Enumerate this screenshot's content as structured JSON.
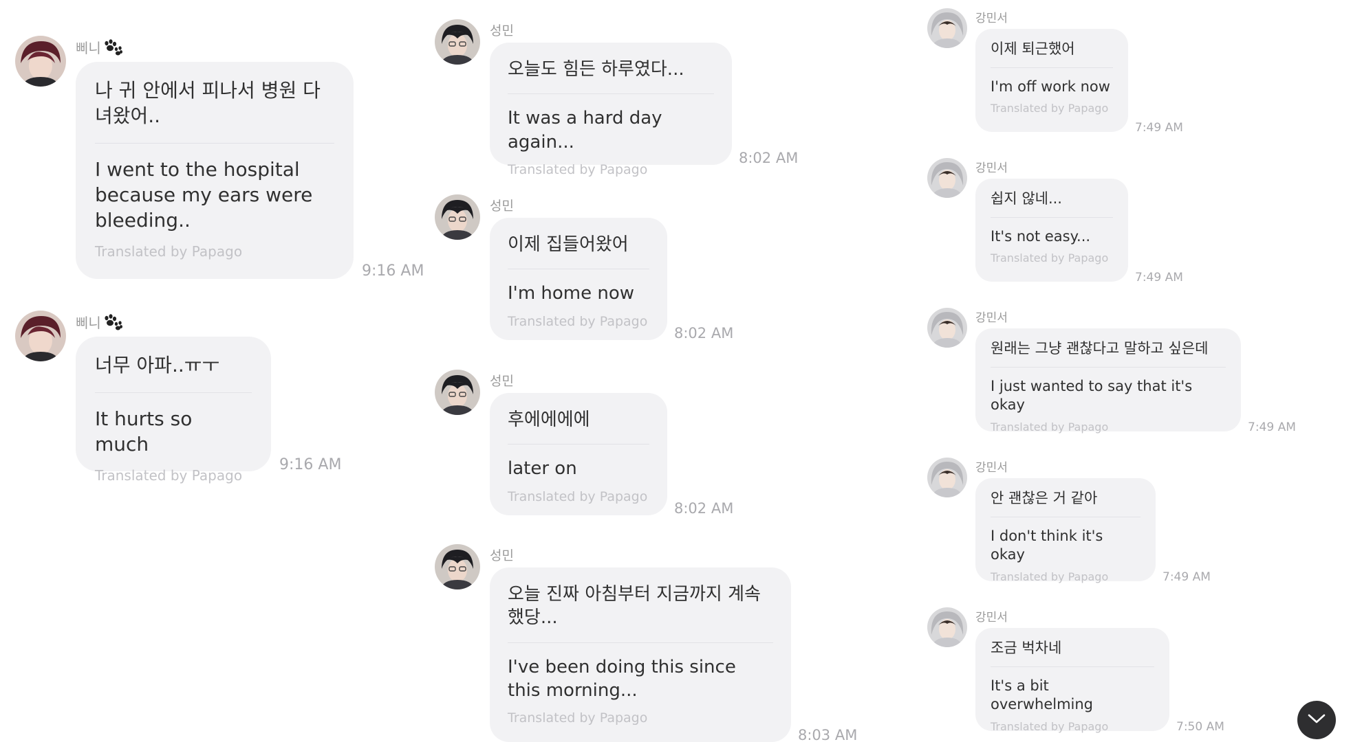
{
  "credit_label": "Translated by Papago",
  "columns": [
    {
      "sender": "삐니",
      "messages": [
        {
          "original": "나 귀 안에서 피나서 병원 다녀왔어..",
          "translation": "I went to the hospital because my ears were bleeding..",
          "time": "9:16 AM"
        },
        {
          "original": "너무 아파..ㅠㅜ",
          "translation": "It hurts so much",
          "time": "9:16 AM"
        }
      ]
    },
    {
      "sender": "성민",
      "messages": [
        {
          "original": "오늘도 힘든 하루였다...",
          "translation": "It was a hard day again...",
          "time": "8:02 AM"
        },
        {
          "original": "이제 집들어왔어",
          "translation": "I'm home now",
          "time": "8:02 AM"
        },
        {
          "original": "후에에에에",
          "translation": "later on",
          "time": "8:02 AM"
        },
        {
          "original": "오늘 진짜 아침부터 지금까지 계속 했당...",
          "translation": "I've been doing this since this morning...",
          "time": "8:03 AM"
        }
      ]
    },
    {
      "sender": "강민서",
      "messages": [
        {
          "original": "이제 퇴근했어",
          "translation": "I'm off work now",
          "time": "7:49 AM"
        },
        {
          "original": "쉽지 않네...",
          "translation": "It's not easy...",
          "time": "7:49 AM"
        },
        {
          "original": "원래는 그냥 괜찮다고 말하고 싶은데",
          "translation": "I just wanted to say that it's okay",
          "time": "7:49 AM"
        },
        {
          "original": "안 괜찮은 거 같아",
          "translation": "I don't think it's okay",
          "time": "7:49 AM"
        },
        {
          "original": "조금 벅차네",
          "translation": "It's a bit overwhelming",
          "time": "7:50 AM"
        }
      ]
    }
  ],
  "icons": {
    "sender_emoji": "paw-prints-icon",
    "scroll_button": "chevron-down-icon"
  },
  "colors": {
    "bubble": "#f2f2f4",
    "scroll_button": "#2e2e30"
  }
}
